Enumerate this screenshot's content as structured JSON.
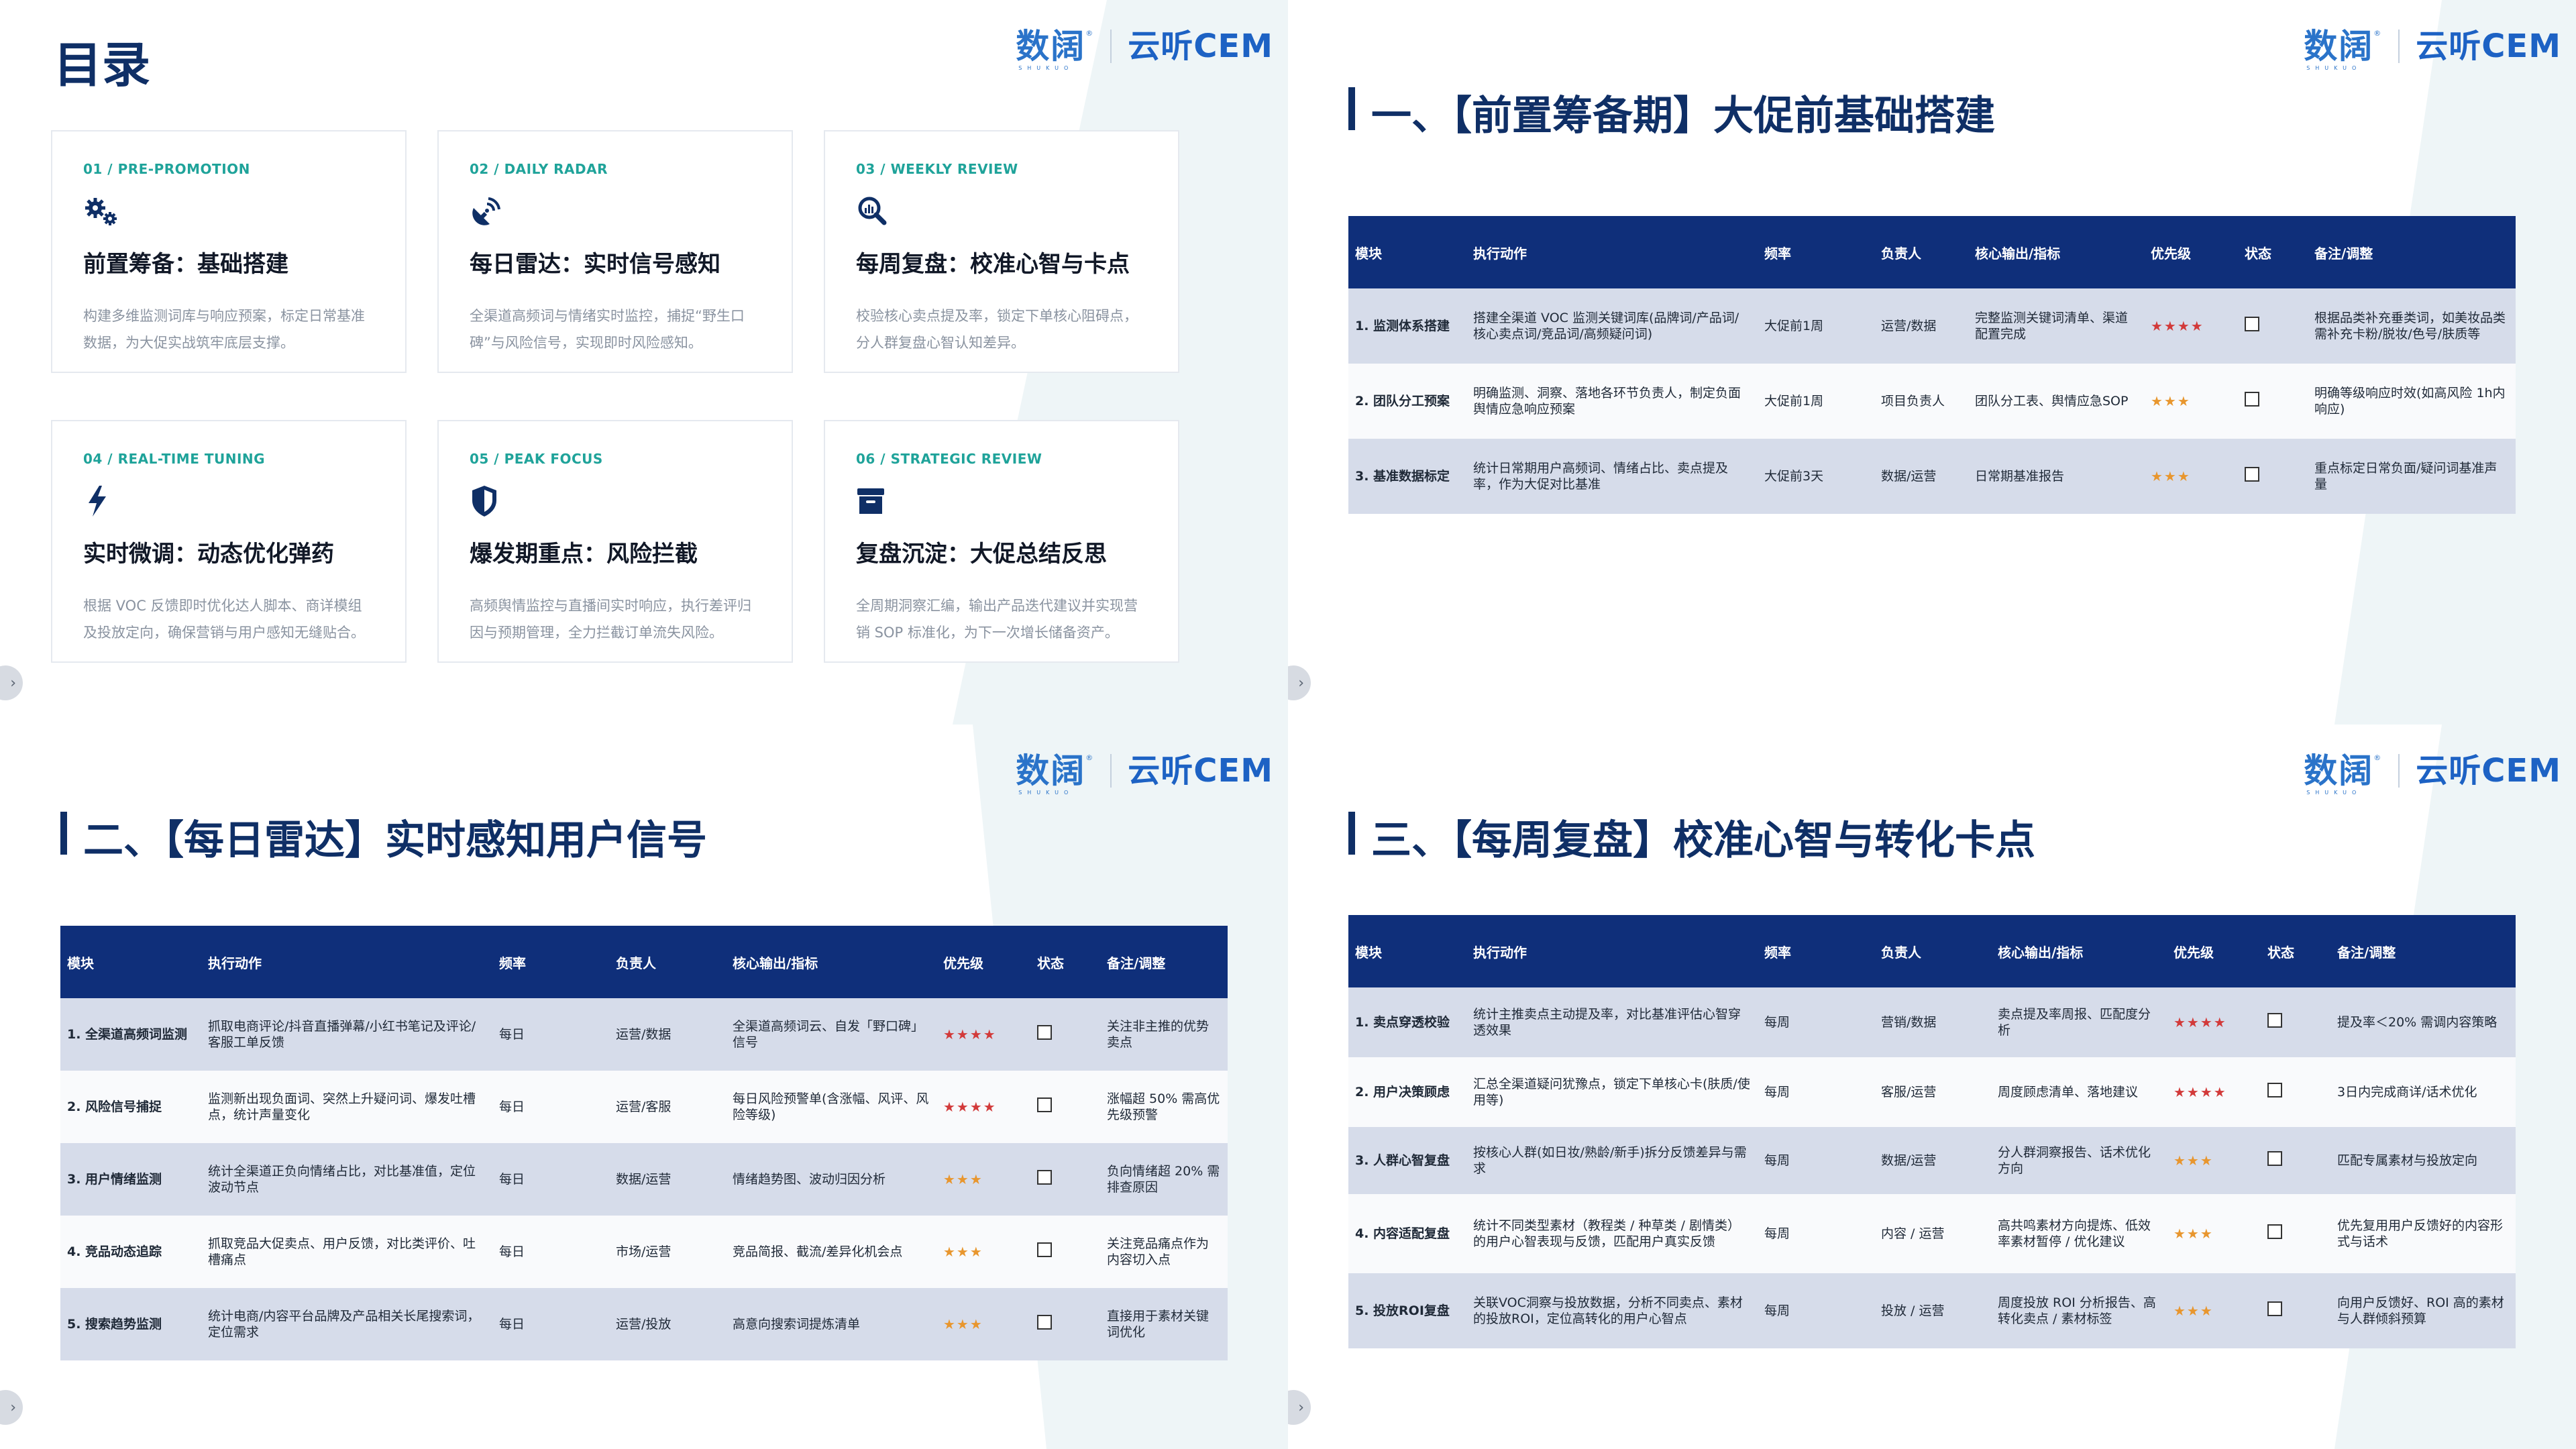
{
  "logo": {
    "brand1": "数阔",
    "brand1_sub": "SHUKUO",
    "brand2": "云听CEM"
  },
  "toc": {
    "title": "目录",
    "cards": [
      {
        "tag": "01 / PRE-PROMOTION",
        "icon": "gears-icon",
        "title": "前置筹备：基础搭建",
        "desc": "构建多维监测词库与响应预案，标定日常基准数据，为大促实战筑牢底层支撑。"
      },
      {
        "tag": "02 / DAILY RADAR",
        "icon": "satellite-dish-icon",
        "title": "每日雷达：实时信号感知",
        "desc": "全渠道高频词与情绪实时监控，捕捉“野生口碑”与风险信号，实现即时风险感知。"
      },
      {
        "tag": "03 / WEEKLY REVIEW",
        "icon": "magnifier-chart-icon",
        "title": "每周复盘：校准心智与卡点",
        "desc": "校验核心卖点提及率，锁定下单核心阻碍点，分人群复盘心智认知差异。"
      },
      {
        "tag": "04 / REAL-TIME TUNING",
        "icon": "lightning-icon",
        "title": "实时微调：动态优化弹药",
        "desc": "根据 VOC 反馈即时优化达人脚本、商详模组及投放定向，确保营销与用户感知无缝贴合。"
      },
      {
        "tag": "05 / PEAK FOCUS",
        "icon": "shield-icon",
        "title": "爆发期重点：风险拦截",
        "desc": "高频舆情监控与直播间实时响应，执行差评归因与预期管理，全力拦截订单流失风险。"
      },
      {
        "tag": "06 / STRATEGIC REVIEW",
        "icon": "archive-box-icon",
        "title": "复盘沉淀：大促总结反思",
        "desc": "全周期洞察汇编，输出产品迭代建议并实现营销 SOP 标准化，为下一次增长储备资产。"
      }
    ]
  },
  "headers": [
    "模块",
    "执行动作",
    "频率",
    "负责人",
    "核心输出/指标",
    "优先级",
    "状态",
    "备注/调整"
  ],
  "sections": [
    {
      "title": "一、【前置筹备期】大促前基础搭建",
      "rows": [
        {
          "module": "1. 监测体系搭建",
          "action": "搭建全渠道 VOC 监测关键词库(品牌词/产品词/核心卖点词/竞品词/高频疑问词)",
          "freq": "大促前1周",
          "owner": "运营/数据",
          "output": "完整监测关键词清单、渠道配置完成",
          "priority": "★★★★",
          "note": "根据品类补充垂类词，如美妆品类需补充卡粉/脱妆/色号/肤质等"
        },
        {
          "module": "2. 团队分工预案",
          "action": "明确监测、洞察、落地各环节负责人，制定负面舆情应急响应预案",
          "freq": "大促前1周",
          "owner": "项目负责人",
          "output": "团队分工表、舆情应急SOP",
          "priority": "★★★",
          "note": "明确等级响应时效(如高风险 1h内响应)"
        },
        {
          "module": "3. 基准数据标定",
          "action": "统计日常期用户高频词、情绪占比、卖点提及率，作为大促对比基准",
          "freq": "大促前3天",
          "owner": "数据/运营",
          "output": "日常期基准报告",
          "priority": "★★★",
          "note": "重点标定日常负面/疑问词基准声量"
        }
      ]
    },
    {
      "title": "二、【每日雷达】实时感知用户信号",
      "rows": [
        {
          "module": "1. 全渠道高频词监测",
          "action": "抓取电商评论/抖音直播弹幕/小红书笔记及评论/客服工单反馈",
          "freq": "每日",
          "owner": "运营/数据",
          "output": "全渠道高频词云、自发「野口碑」信号",
          "priority": "★★★★",
          "note": "关注非主推的优势卖点"
        },
        {
          "module": "2. 风险信号捕捉",
          "action": "监测新出现负面词、突然上升疑问词、爆发吐槽点，统计声量变化",
          "freq": "每日",
          "owner": "运营/客服",
          "output": "每日风险预警单(含涨幅、风评、风险等级)",
          "priority": "★★★★",
          "note": "涨幅超 50% 需高优先级预警"
        },
        {
          "module": "3. 用户情绪监测",
          "action": "统计全渠道正负向情绪占比，对比基准值，定位波动节点",
          "freq": "每日",
          "owner": "数据/运营",
          "output": "情绪趋势图、波动归因分析",
          "priority": "★★★",
          "note": "负向情绪超 20% 需排查原因"
        },
        {
          "module": "4. 竞品动态追踪",
          "action": "抓取竞品大促卖点、用户反馈，对比类评价、吐槽痛点",
          "freq": "每日",
          "owner": "市场/运营",
          "output": "竞品简报、截流/差异化机会点",
          "priority": "★★★",
          "note": "关注竞品痛点作为内容切入点"
        },
        {
          "module": "5. 搜索趋势监测",
          "action": "统计电商/内容平台品牌及产品相关长尾搜索词，定位需求",
          "freq": "每日",
          "owner": "运营/投放",
          "output": "高意向搜索词提炼清单",
          "priority": "★★★",
          "note": "直接用于素材关键词优化"
        }
      ]
    },
    {
      "title": "三、【每周复盘】校准心智与转化卡点",
      "rows": [
        {
          "module": "1. 卖点穿透校验",
          "action": "统计主推卖点主动提及率，对比基准评估心智穿透效果",
          "freq": "每周",
          "owner": "营销/数据",
          "output": "卖点提及率周报、匹配度分析",
          "priority": "★★★★",
          "note": "提及率＜20% 需调内容策略"
        },
        {
          "module": "2. 用户决策顾虑",
          "action": "汇总全渠道疑问犹豫点，锁定下单核心卡(肤质/使用等)",
          "freq": "每周",
          "owner": "客服/运营",
          "output": "周度顾虑清单、落地建议",
          "priority": "★★★★",
          "note": "3日内完成商详/话术优化"
        },
        {
          "module": "3. 人群心智复盘",
          "action": "按核心人群(如日妆/熟龄/新手)拆分反馈差异与需求",
          "freq": "每周",
          "owner": "数据/运营",
          "output": "分人群洞察报告、话术优化方向",
          "priority": "★★★",
          "note": "匹配专属素材与投放定向"
        },
        {
          "module": "4. 内容适配复盘",
          "action": "统计不同类型素材（教程类 / 种草类 / 剧情类）的用户心智表现与反馈，匹配用户真实反馈",
          "freq": "每周",
          "owner": "内容 / 运营",
          "output": "高共鸣素材方向提炼、低效率素材暂停 / 优化建议",
          "priority": "★★★",
          "note": "优先复用用户反馈好的内容形式与话术"
        },
        {
          "module": "5. 投放ROI复盘",
          "action": "关联VOC洞察与投放数据，分析不同卖点、素材的投放ROI，定位高转化的用户心智点",
          "freq": "每周",
          "owner": "投放 / 运营",
          "output": "周度投放 ROI 分析报告、高转化卖点 / 素材标签",
          "priority": "★★★",
          "note": "向用户反馈好、ROI 高的素材与人群倾斜预算"
        }
      ]
    }
  ],
  "colors": {
    "navy": "#0f2f7a",
    "title": "#0f2f66",
    "teal": "#1fa39a",
    "star4": "#d23a3a",
    "star3": "#e8962e"
  }
}
